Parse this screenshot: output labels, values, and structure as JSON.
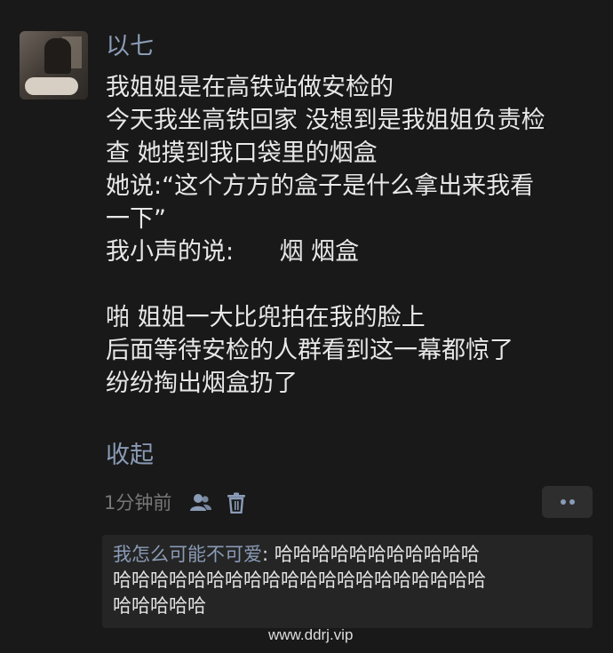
{
  "post": {
    "username": "以七",
    "lines": [
      "我姐姐是在高铁站做安检的",
      "今天我坐高铁回家 没想到是我姐姐负责检",
      "查 她摸到我口袋里的烟盒",
      "她说:“这个方方的盒子是什么拿出来我看",
      "一下”",
      "我小声的说:      烟 烟盒",
      "",
      "啪 姐姐一大比兜拍在我的脸上",
      "后面等待安检的人群看到这一幕都惊了",
      "纷纷掏出烟盒扔了"
    ],
    "collapse_label": "收起",
    "time": "1分钟前",
    "icons": {
      "privacy": "friends-visibility-icon",
      "delete": "trash-icon",
      "more": "more-dots-icon"
    }
  },
  "comment": {
    "author": "我怎么可能不可爱",
    "separator": ": ",
    "line1_text": "哈哈哈哈哈哈哈哈哈哈哈",
    "line2": "哈哈哈哈哈哈哈哈哈哈哈哈哈哈哈哈哈哈哈哈",
    "line3": "哈哈哈哈哈"
  },
  "watermark": "www.ddrj.vip",
  "colors": {
    "background": "#191919",
    "text": "#e8e8e8",
    "link": "#8a9bb6",
    "secondary": "#777777",
    "comment_bg": "#252525"
  }
}
